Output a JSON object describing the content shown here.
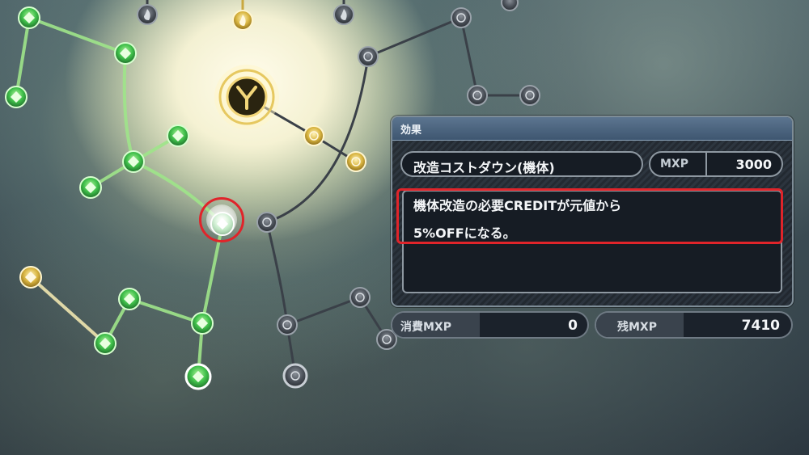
{
  "panel": {
    "title": "効果",
    "effect_name": "改造コストダウン(機体)",
    "cost_label": "MXP",
    "cost_value": "3000",
    "description_line1": "機体改造の必要CREDITが元値から",
    "description_line2": "5%OFFになる。"
  },
  "stats": {
    "spent_label": "消費MXP",
    "spent_value": "0",
    "remaining_label": "残MXP",
    "remaining_value": "7410"
  },
  "colors": {
    "unlocked_node": "#3fbf4a",
    "gold_node": "#d8b440",
    "locked_node": "#4a5058",
    "selection_highlight": "#e0242a",
    "panel_header": "#4d6680"
  },
  "icons": {
    "center_emblem": "y-emblem-icon",
    "flame": "flame-icon",
    "atom": "atom-icon",
    "diamond": "diamond-icon"
  }
}
